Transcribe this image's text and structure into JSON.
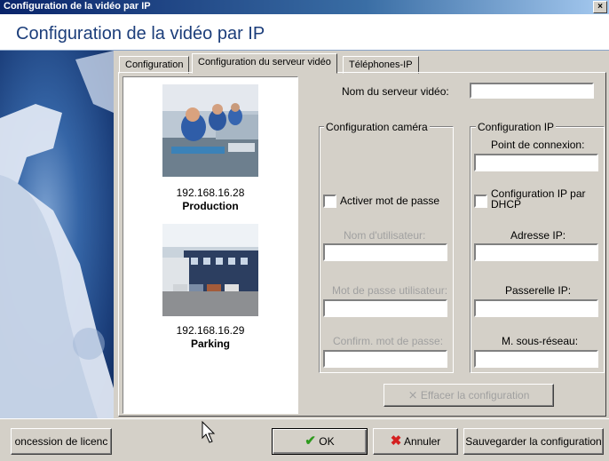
{
  "window": {
    "title": "Configuration de la vidéo par IP",
    "close_glyph": "×"
  },
  "header": {
    "title": "Configuration de la vidéo par IP"
  },
  "tabs": [
    {
      "label": "Configuration"
    },
    {
      "label": "Configuration du serveur vidéo"
    },
    {
      "label": "Téléphones-IP"
    }
  ],
  "cameras": [
    {
      "ip": "192.168.16.28",
      "name": "Production"
    },
    {
      "ip": "192.168.16.29",
      "name": "Parking"
    }
  ],
  "server": {
    "name_label": "Nom du serveur vidéo:",
    "name_value": ""
  },
  "camera_config": {
    "title": "Configuration caméra",
    "password_checkbox": "Activer mot de passe",
    "user_label": "Nom d'utilisateur:",
    "password_label": "Mot de passe utilisateur:",
    "confirm_label": "Confirm. mot de passe:"
  },
  "ip_config": {
    "title": "Configuration IP",
    "connection_point_label": "Point de connexion:",
    "dhcp_line1": "Configuration IP par",
    "dhcp_line2": "DHCP",
    "ip_label": "Adresse IP:",
    "gateway_label": "Passerelle IP:",
    "mask_label": "M. sous-réseau:"
  },
  "buttons": {
    "clear": "Effacer la configuration",
    "license": "oncession de licenc",
    "ok": "OK",
    "cancel": "Annuler",
    "save": "Sauvegarder la configuration"
  },
  "colors": {
    "title_bar": "#0a246a",
    "header_text": "#1b3d7a",
    "ok_check": "#2e9a1e",
    "cancel_x": "#d42020"
  }
}
